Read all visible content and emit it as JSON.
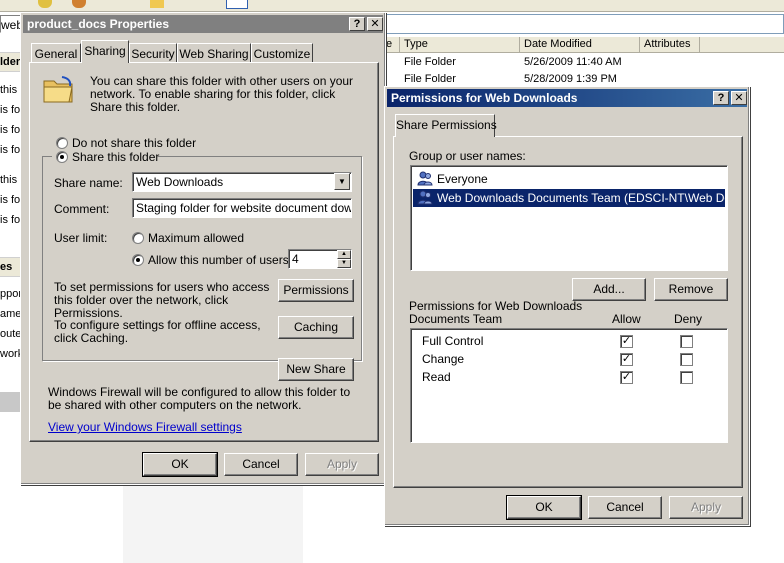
{
  "background": {
    "address_fragment": "web",
    "sidebar_fragments": [
      "this",
      "is fo",
      "is fo",
      "is fo",
      "this",
      "is fo",
      "is fo",
      "is fo",
      "nis fo"
    ],
    "sidebar_heading_1": "lder",
    "sidebar_heading_2": "es",
    "sidebar_fragments_2": [
      "pport",
      "amen",
      "oute",
      "work"
    ],
    "columns": [
      "e",
      "Type",
      "Date Modified",
      "Attributes"
    ],
    "files": [
      {
        "type": "File Folder",
        "date": "5/26/2009 11:40 AM"
      },
      {
        "type": "File Folder",
        "date": "5/28/2009 1:39 PM"
      }
    ]
  },
  "properties_dialog": {
    "title": "product_docs Properties",
    "help_label": "?",
    "close_label": "✕",
    "tabs": [
      "General",
      "Sharing",
      "Security",
      "Web Sharing",
      "Customize"
    ],
    "active_tab": "Sharing",
    "intro_text": "You can share this folder with other users on your network.  To enable sharing for this folder, click Share this folder.",
    "do_not_share_label": "Do not share this folder",
    "share_label": "Share this folder",
    "share_name_label": "Share name:",
    "share_name_value": "Web Downloads",
    "comment_label": "Comment:",
    "comment_value": "Staging folder for website document downloads",
    "user_limit_label": "User limit:",
    "max_allowed_label": "Maximum allowed",
    "allow_users_label": "Allow this number of users:",
    "allow_users_value": "4",
    "permissions_text": "To set permissions for users who access this folder over the network, click Permissions.",
    "permissions_button": "Permissions",
    "caching_text": "To configure settings for offline access, click Caching.",
    "caching_button": "Caching",
    "new_share_button": "New Share",
    "firewall_text": "Windows Firewall will be configured to allow this folder to be shared with other computers on the network.",
    "firewall_link": "View your Windows Firewall settings",
    "ok_button": "OK",
    "cancel_button": "Cancel",
    "apply_button": "Apply"
  },
  "permissions_dialog": {
    "title": "Permissions for Web Downloads",
    "help_label": "?",
    "close_label": "✕",
    "tab": "Share Permissions",
    "group_label": "Group or user names:",
    "users": [
      {
        "name": "Everyone",
        "selected": false
      },
      {
        "name": "Web Downloads Documents Team (EDSCI-NT\\Web Down...",
        "selected": true
      }
    ],
    "add_button": "Add...",
    "remove_button": "Remove",
    "perm_header_line1": "Permissions for Web Downloads",
    "perm_header_line2": "Documents Team",
    "allow_header": "Allow",
    "deny_header": "Deny",
    "permissions": [
      {
        "name": "Full Control",
        "allow": true,
        "deny": false
      },
      {
        "name": "Change",
        "allow": true,
        "deny": false
      },
      {
        "name": "Read",
        "allow": true,
        "deny": false
      }
    ],
    "ok_button": "OK",
    "cancel_button": "Cancel",
    "apply_button": "Apply"
  }
}
